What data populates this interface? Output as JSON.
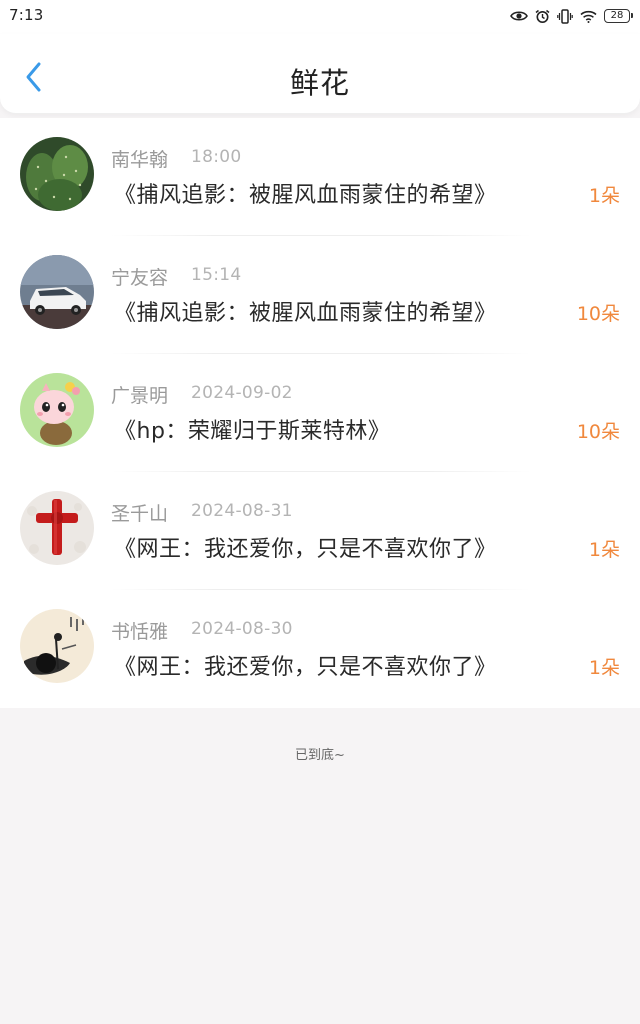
{
  "status_bar": {
    "time": "7:13",
    "battery": "28",
    "icons": [
      "eye-icon",
      "alarm-icon",
      "vibrate-icon",
      "wifi-icon",
      "battery-icon"
    ]
  },
  "header": {
    "back_icon": "chevron-left-icon",
    "title": "鲜花",
    "accent_color": "#3a9ae8"
  },
  "items": [
    {
      "name": "南华翰",
      "time": "18:00",
      "book": "《捕风追影：被腥风血雨蒙住的希望》",
      "count": "1朵",
      "avatar": "cactus"
    },
    {
      "name": "宁友容",
      "time": "15:14",
      "book": "《捕风追影：被腥风血雨蒙住的希望》",
      "count": "10朵",
      "avatar": "white-car"
    },
    {
      "name": "广景明",
      "time": "2024-09-02",
      "book": "《hp：荣耀归于斯莱特林》",
      "count": "10朵",
      "avatar": "cartoon-character"
    },
    {
      "name": "圣千山",
      "time": "2024-08-31",
      "book": "《网王：我还爱你，只是不喜欢你了》",
      "count": "1朵",
      "avatar": "red-cross"
    },
    {
      "name": "书恬雅",
      "time": "2024-08-30",
      "book": "《网王：我还爱你，只是不喜欢你了》",
      "count": "1朵",
      "avatar": "ink-painting"
    }
  ],
  "colors": {
    "count_orange": "#f0883d",
    "name_gray": "#9a9a9a",
    "time_gray": "#b4b4b4"
  },
  "footer": {
    "end_text": "已到底~"
  }
}
